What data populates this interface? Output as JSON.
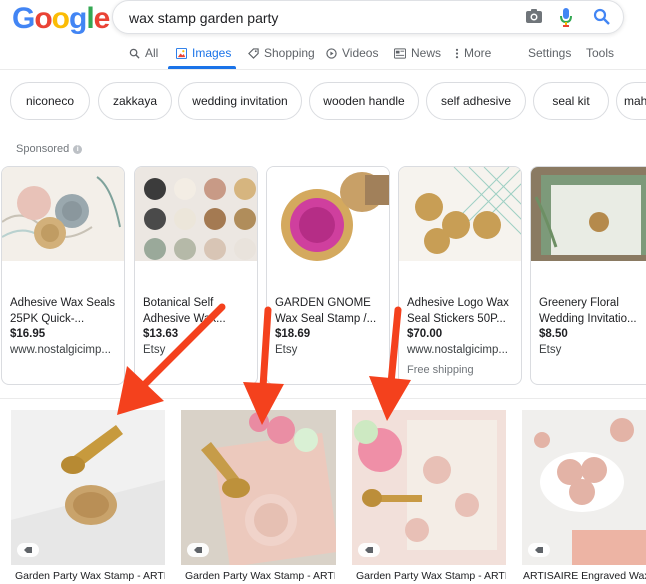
{
  "logo": {
    "text": "Google",
    "colors": [
      "#4285F4",
      "#EA4335",
      "#FBBC05",
      "#4285F4",
      "#34A853",
      "#EA4335"
    ]
  },
  "search": {
    "query": "wax stamp garden party"
  },
  "nav": {
    "tabs": [
      {
        "label": "All",
        "icon": "search-icon"
      },
      {
        "label": "Images",
        "icon": "image-icon"
      },
      {
        "label": "Shopping",
        "icon": "tag-icon"
      },
      {
        "label": "Videos",
        "icon": "video-icon"
      },
      {
        "label": "News",
        "icon": "news-icon"
      },
      {
        "label": "More",
        "icon": "more-icon"
      }
    ],
    "settings": "Settings",
    "tools": "Tools"
  },
  "chips": [
    "niconeco",
    "zakkaya",
    "wedding invitation",
    "wooden handle",
    "self adhesive",
    "seal kit",
    "mah"
  ],
  "sponsored_label": "Sponsored",
  "products": [
    {
      "title": "Adhesive Wax Seals 25PK Quick-...",
      "price": "$16.95",
      "store": "www.nostalgicimp...",
      "shipping": ""
    },
    {
      "title": "Botanical Self Adhesive Wax...",
      "price": "$13.63",
      "store": "Etsy",
      "shipping": ""
    },
    {
      "title": "GARDEN GNOME Wax Seal Stamp /...",
      "price": "$18.69",
      "store": "Etsy",
      "shipping": ""
    },
    {
      "title": "Adhesive Logo Wax Seal Stickers 50P...",
      "price": "$70.00",
      "store": "www.nostalgicimp...",
      "shipping": "Free shipping"
    },
    {
      "title": "Greenery Floral Wedding Invitatio...",
      "price": "$8.50",
      "store": "Etsy",
      "shipping": ""
    }
  ],
  "results": [
    {
      "caption": "Garden Party Wax Stamp - ARTI..."
    },
    {
      "caption": "Garden Party Wax Stamp - ARTI..."
    },
    {
      "caption": "Garden Party Wax Stamp - ARTI..."
    },
    {
      "caption": "ARTISAIRE Engraved Wax S..."
    }
  ],
  "colors": {
    "accent": "#1a73e8",
    "arrow": "#f4411d"
  }
}
